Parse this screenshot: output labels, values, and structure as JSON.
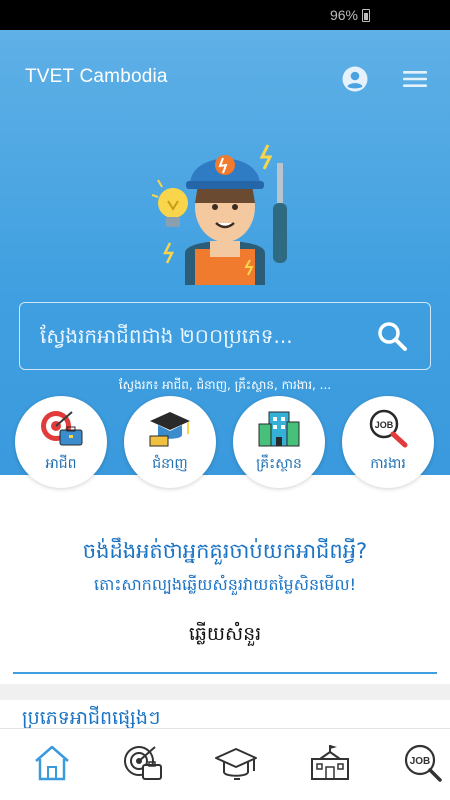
{
  "status": {
    "battery": "96%"
  },
  "header": {
    "title": "TVET Cambodia",
    "user_icon": "user-icon",
    "menu_icon": "menu-icon"
  },
  "colors": {
    "primary": "#3f9fe0",
    "text_blue": "#1a73c4"
  },
  "search": {
    "placeholder": "ស្វែងរកអាជីពជាង ២០០ប្រភេទ...",
    "hint": "ស្វែងរក៖ អាជីព, ជំនាញ, គ្រឹះស្ថាន, ការងារ, ..."
  },
  "categories": [
    {
      "label": "អាជីព",
      "icon": "career-icon"
    },
    {
      "label": "ជំនាញ",
      "icon": "skill-icon"
    },
    {
      "label": "គ្រឹះស្ថាន",
      "icon": "institution-icon"
    },
    {
      "label": "ការងារ",
      "icon": "job-icon"
    }
  ],
  "quiz": {
    "title": "ចង់ដឹងអត់ថាអ្នកគួរចាប់យកអាជីពអ្វី?",
    "subtitle": "តោះសាកល្បងឆ្លើយសំនួរវាយតម្លៃសិនមើល!",
    "button": "ឆ្លើយសំនួរ"
  },
  "section": {
    "title": "ប្រភេទអាជីពផ្សេងៗ"
  },
  "bottom_nav": [
    {
      "icon": "home-icon",
      "active": true
    },
    {
      "icon": "career-icon",
      "active": false
    },
    {
      "icon": "graduation-cap-icon",
      "active": false
    },
    {
      "icon": "school-building-icon",
      "active": false
    },
    {
      "icon": "job-search-icon",
      "active": false
    }
  ]
}
